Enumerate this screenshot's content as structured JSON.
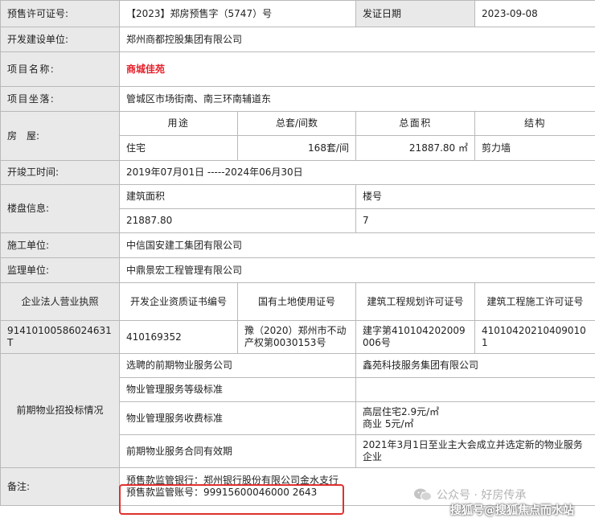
{
  "permit": {
    "label_permit_no": "预售许可证号:",
    "permit_no": "【2023】郑房预售字（5747）号",
    "label_issue_date": "发证日期",
    "issue_date": "2023-09-08",
    "label_developer": "开发建设单位:",
    "developer": "郑州商都控股集团有限公司",
    "label_project_name": "项目名称:",
    "project_name": "商城佳苑",
    "label_location": "项目坐落:",
    "location": "管城区市场街南、南三环南辅道东",
    "label_housing": "房　屋:",
    "housing": {
      "headers": [
        "用途",
        "总套/间数",
        "总面积",
        "结构"
      ],
      "use": "住宅",
      "count": "168套/间",
      "area": "21887.80 ㎡",
      "structure": "剪力墙"
    },
    "label_construction_period": "开竣工时间:",
    "construction_period": "2019年07月01日 -----2024年06月30日",
    "label_building_info": "楼盘信息:",
    "building_info": {
      "area_header": "建筑面积",
      "building_header": "楼号",
      "area": "21887.80",
      "building": "7"
    },
    "label_contractor": "施工单位:",
    "contractor": "中信国安建工集团有限公司",
    "label_supervisor": "监理单位:",
    "supervisor": "中鼎景宏工程管理有限公司",
    "license_headers": {
      "business_license": "企业法人营业执照",
      "qualification": "开发企业资质证书编号",
      "land_use": "国有土地使用证号",
      "planning": "建筑工程规划许可证号",
      "construction": "建筑工程施工许可证号"
    },
    "license_values": {
      "business_license": "91410100586024631T",
      "qualification": "410169352",
      "land_use": "豫（2020）郑州市不动产权第0030153号",
      "planning": "建字第410104202009006号",
      "construction": "410104202104090101"
    },
    "label_property": "前期物业招投标情况",
    "property": {
      "company_label": "选聘的前期物业服务公司",
      "company": "鑫苑科技服务集团有限公司",
      "grade_label": "物业管理服务等级标准",
      "grade": "",
      "fee_label": "物业管理服务收费标准",
      "fee_line1": "高层住宅2.9元/㎡",
      "fee_line2": "商业 5元/㎡",
      "contract_label": "前期物业服务合同有效期",
      "contract": "2021年3月1日至业主大会成立并选定新的物业服务企业"
    },
    "label_remarks": "备注:",
    "remarks_line1": "预售款监管银行：郑州银行股份有限公司金水支行",
    "remarks_line2": "预售款监管账号：99915600046000 2643"
  },
  "watermark": {
    "wechat_text": "公众号 · 好房传承",
    "sohu_text": "搜狐号@搜狐焦点而水站"
  },
  "colors": {
    "label_bg": "#e9e9e9",
    "border": "#b9b9b9",
    "title_red": "#e5202a",
    "highlight_box": "#e0302e"
  }
}
